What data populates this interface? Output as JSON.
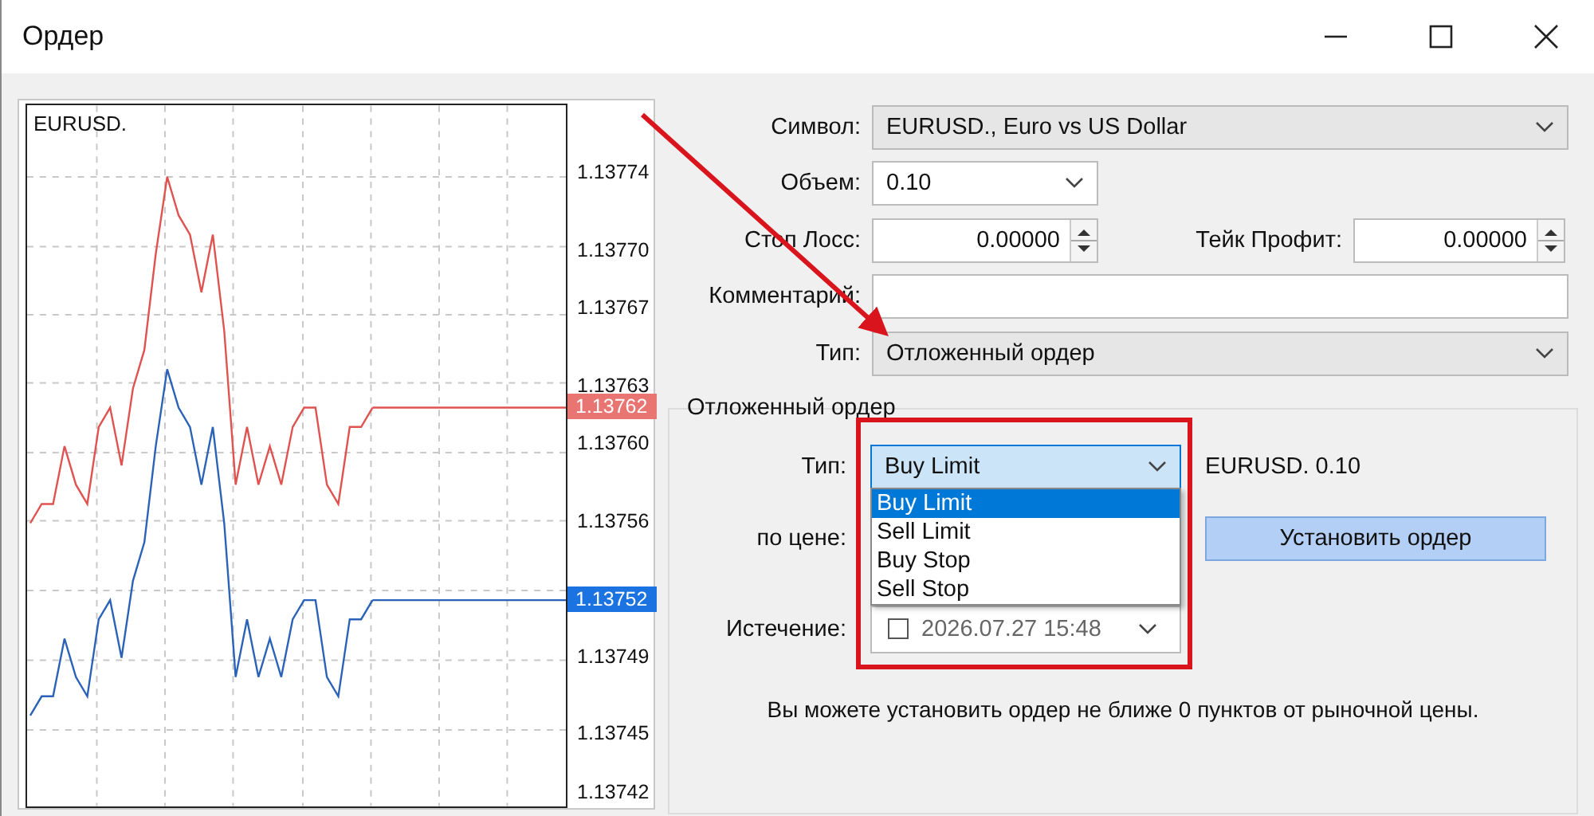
{
  "window": {
    "title": "Ордер"
  },
  "chart": {
    "symbol": "EURUSD.",
    "ask_label": "1.13762",
    "bid_label": "1.13752",
    "chart_data": {
      "type": "line",
      "grid": true,
      "ylim": [
        1.137413,
        1.137777
      ],
      "yticks": [
        {
          "value": 1.13774,
          "label": "1.13774"
        },
        {
          "value": 1.1377,
          "label": "1.13770"
        },
        {
          "value": 1.13767,
          "label": "1.13767"
        },
        {
          "value": 1.13763,
          "label": "1.13763"
        },
        {
          "value": 1.1376,
          "label": "1.13760"
        },
        {
          "value": 1.13756,
          "label": "1.13756"
        },
        {
          "value": 1.13749,
          "label": "1.13749"
        },
        {
          "value": 1.13745,
          "label": "1.13745"
        },
        {
          "value": 1.13742,
          "label": "1.13742"
        }
      ],
      "series": [
        {
          "color": "#e0524f",
          "values": [
            1.13756,
            1.13757,
            1.13757,
            1.1376,
            1.13758,
            1.13757,
            1.13761,
            1.13762,
            1.13759,
            1.13763,
            1.13765,
            1.1377,
            1.13774,
            1.13772,
            1.13771,
            1.13768,
            1.13771,
            1.13766,
            1.13758,
            1.13761,
            1.13758,
            1.1376,
            1.13758,
            1.13761,
            1.13762,
            1.13762,
            1.13758,
            1.13757,
            1.13761,
            1.13761,
            1.13762
          ]
        },
        {
          "color": "#2a62b8",
          "values": [
            1.13746,
            1.13747,
            1.13747,
            1.1375,
            1.13748,
            1.13747,
            1.13751,
            1.13752,
            1.13749,
            1.13753,
            1.13755,
            1.1376,
            1.13764,
            1.13762,
            1.13761,
            1.13758,
            1.13761,
            1.13756,
            1.13748,
            1.13751,
            1.13748,
            1.1375,
            1.13748,
            1.13751,
            1.13752,
            1.13752,
            1.13748,
            1.13747,
            1.13751,
            1.13751,
            1.13752
          ]
        }
      ]
    }
  },
  "form": {
    "symbol": {
      "label": "Символ:",
      "value": "EURUSD., Euro vs US Dollar"
    },
    "volume": {
      "label": "Объем:",
      "value": "0.10"
    },
    "stop_loss": {
      "label": "Стоп Лосс:",
      "value": "0.00000"
    },
    "take_profit": {
      "label": "Тейк Профит:",
      "value": "0.00000"
    },
    "comment": {
      "label": "Комментарий:"
    },
    "type": {
      "label": "Тип:",
      "value": "Отложенный ордер"
    }
  },
  "pending": {
    "title": "Отложенный ордер",
    "type": {
      "label": "Тип:",
      "value": "Buy Limit",
      "expanded": true,
      "options": [
        {
          "label": "Buy Limit",
          "selected": true
        },
        {
          "label": "Sell Limit",
          "selected": false
        },
        {
          "label": "Buy Stop",
          "selected": false
        },
        {
          "label": "Sell Stop",
          "selected": false
        }
      ]
    },
    "summary": "EURUSD. 0.10",
    "price": {
      "label": "по цене:"
    },
    "submit": "Установить ордер",
    "expiration": {
      "label": "Истечение:",
      "checked": false,
      "value": "2026.07.27 15:48"
    },
    "note": "Вы можете установить ордер не ближе 0 пунктов от рыночной цены."
  }
}
